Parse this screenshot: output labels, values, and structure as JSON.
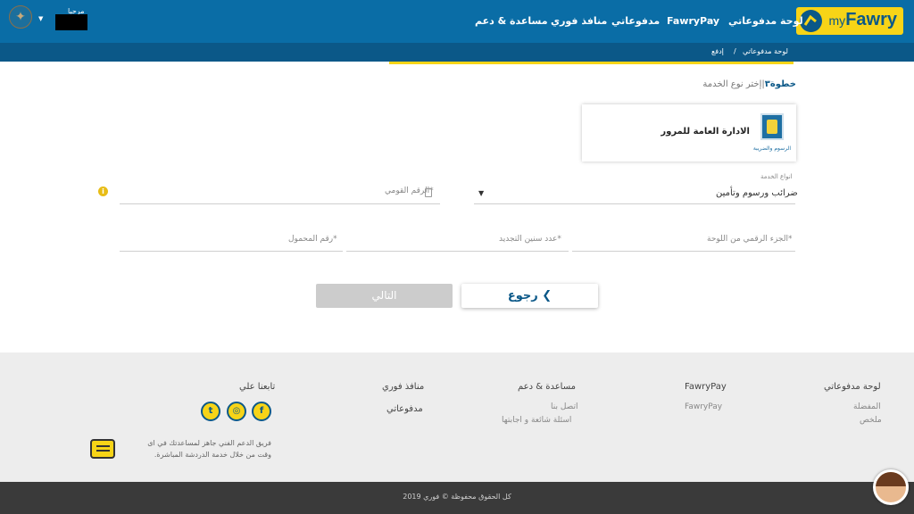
{
  "header": {
    "logo_my": "my",
    "logo_fawry": "Fawry",
    "nav": {
      "dashboard": "لوحة مدفوعاتي",
      "fawrypay": "FawryPay",
      "payments": "مدفوعاتي",
      "outlets": "منافذ فوري",
      "help": "مساعدة & دعم"
    },
    "hello": "مرحبا"
  },
  "breadcrumb": {
    "home": "لوحة مدفوعاتي",
    "separator": "/",
    "current": "إدفع"
  },
  "step": {
    "label": "خطوة٣",
    "separator": "|",
    "text": "إختر نوع الخدمة"
  },
  "service": {
    "name": "الادارة العامة للمرور",
    "icon_caption": "الرسوم والضريبة"
  },
  "form": {
    "service_type_label": "انواع الخدمة",
    "service_type_value": "ضرائب ورسوم وتأمين",
    "national_id_placeholder": "الرقم القومي*",
    "plate_number_placeholder": "الجزء الرقمي من اللوحة*",
    "renewal_years_placeholder": "عدد سنين التجديد*",
    "mobile_placeholder": "رقم المحمول*"
  },
  "buttons": {
    "back": "رجوع",
    "next": "التالي"
  },
  "footer": {
    "col_dashboard": {
      "title": "لوحة مدفوعاتي",
      "links": [
        "المفضلة",
        "ملخص"
      ]
    },
    "col_fawrypay": {
      "title": "FawryPay",
      "links": [
        "FawryPay"
      ]
    },
    "col_help": {
      "title": "مساعدة & دعم",
      "links": [
        "اتصل بنا",
        "اسئلة شائعة و اجابتها"
      ]
    },
    "col_outlets": {
      "title": "منافذ فوري",
      "links": [
        "مدفوعاتي"
      ]
    },
    "col_follow": {
      "title": "تابعنا علي"
    },
    "support_text": "فريق الدعم الفني جاهز لمساعدتك في اى وقت من خلال خدمة الدردشة المباشرة.",
    "copyright": "كل الحقوق محفوظة © فوري 2019"
  },
  "colors": {
    "brand_blue": "#0a6da6",
    "brand_dark_blue": "#0b5888",
    "brand_yellow": "#f7d417"
  }
}
